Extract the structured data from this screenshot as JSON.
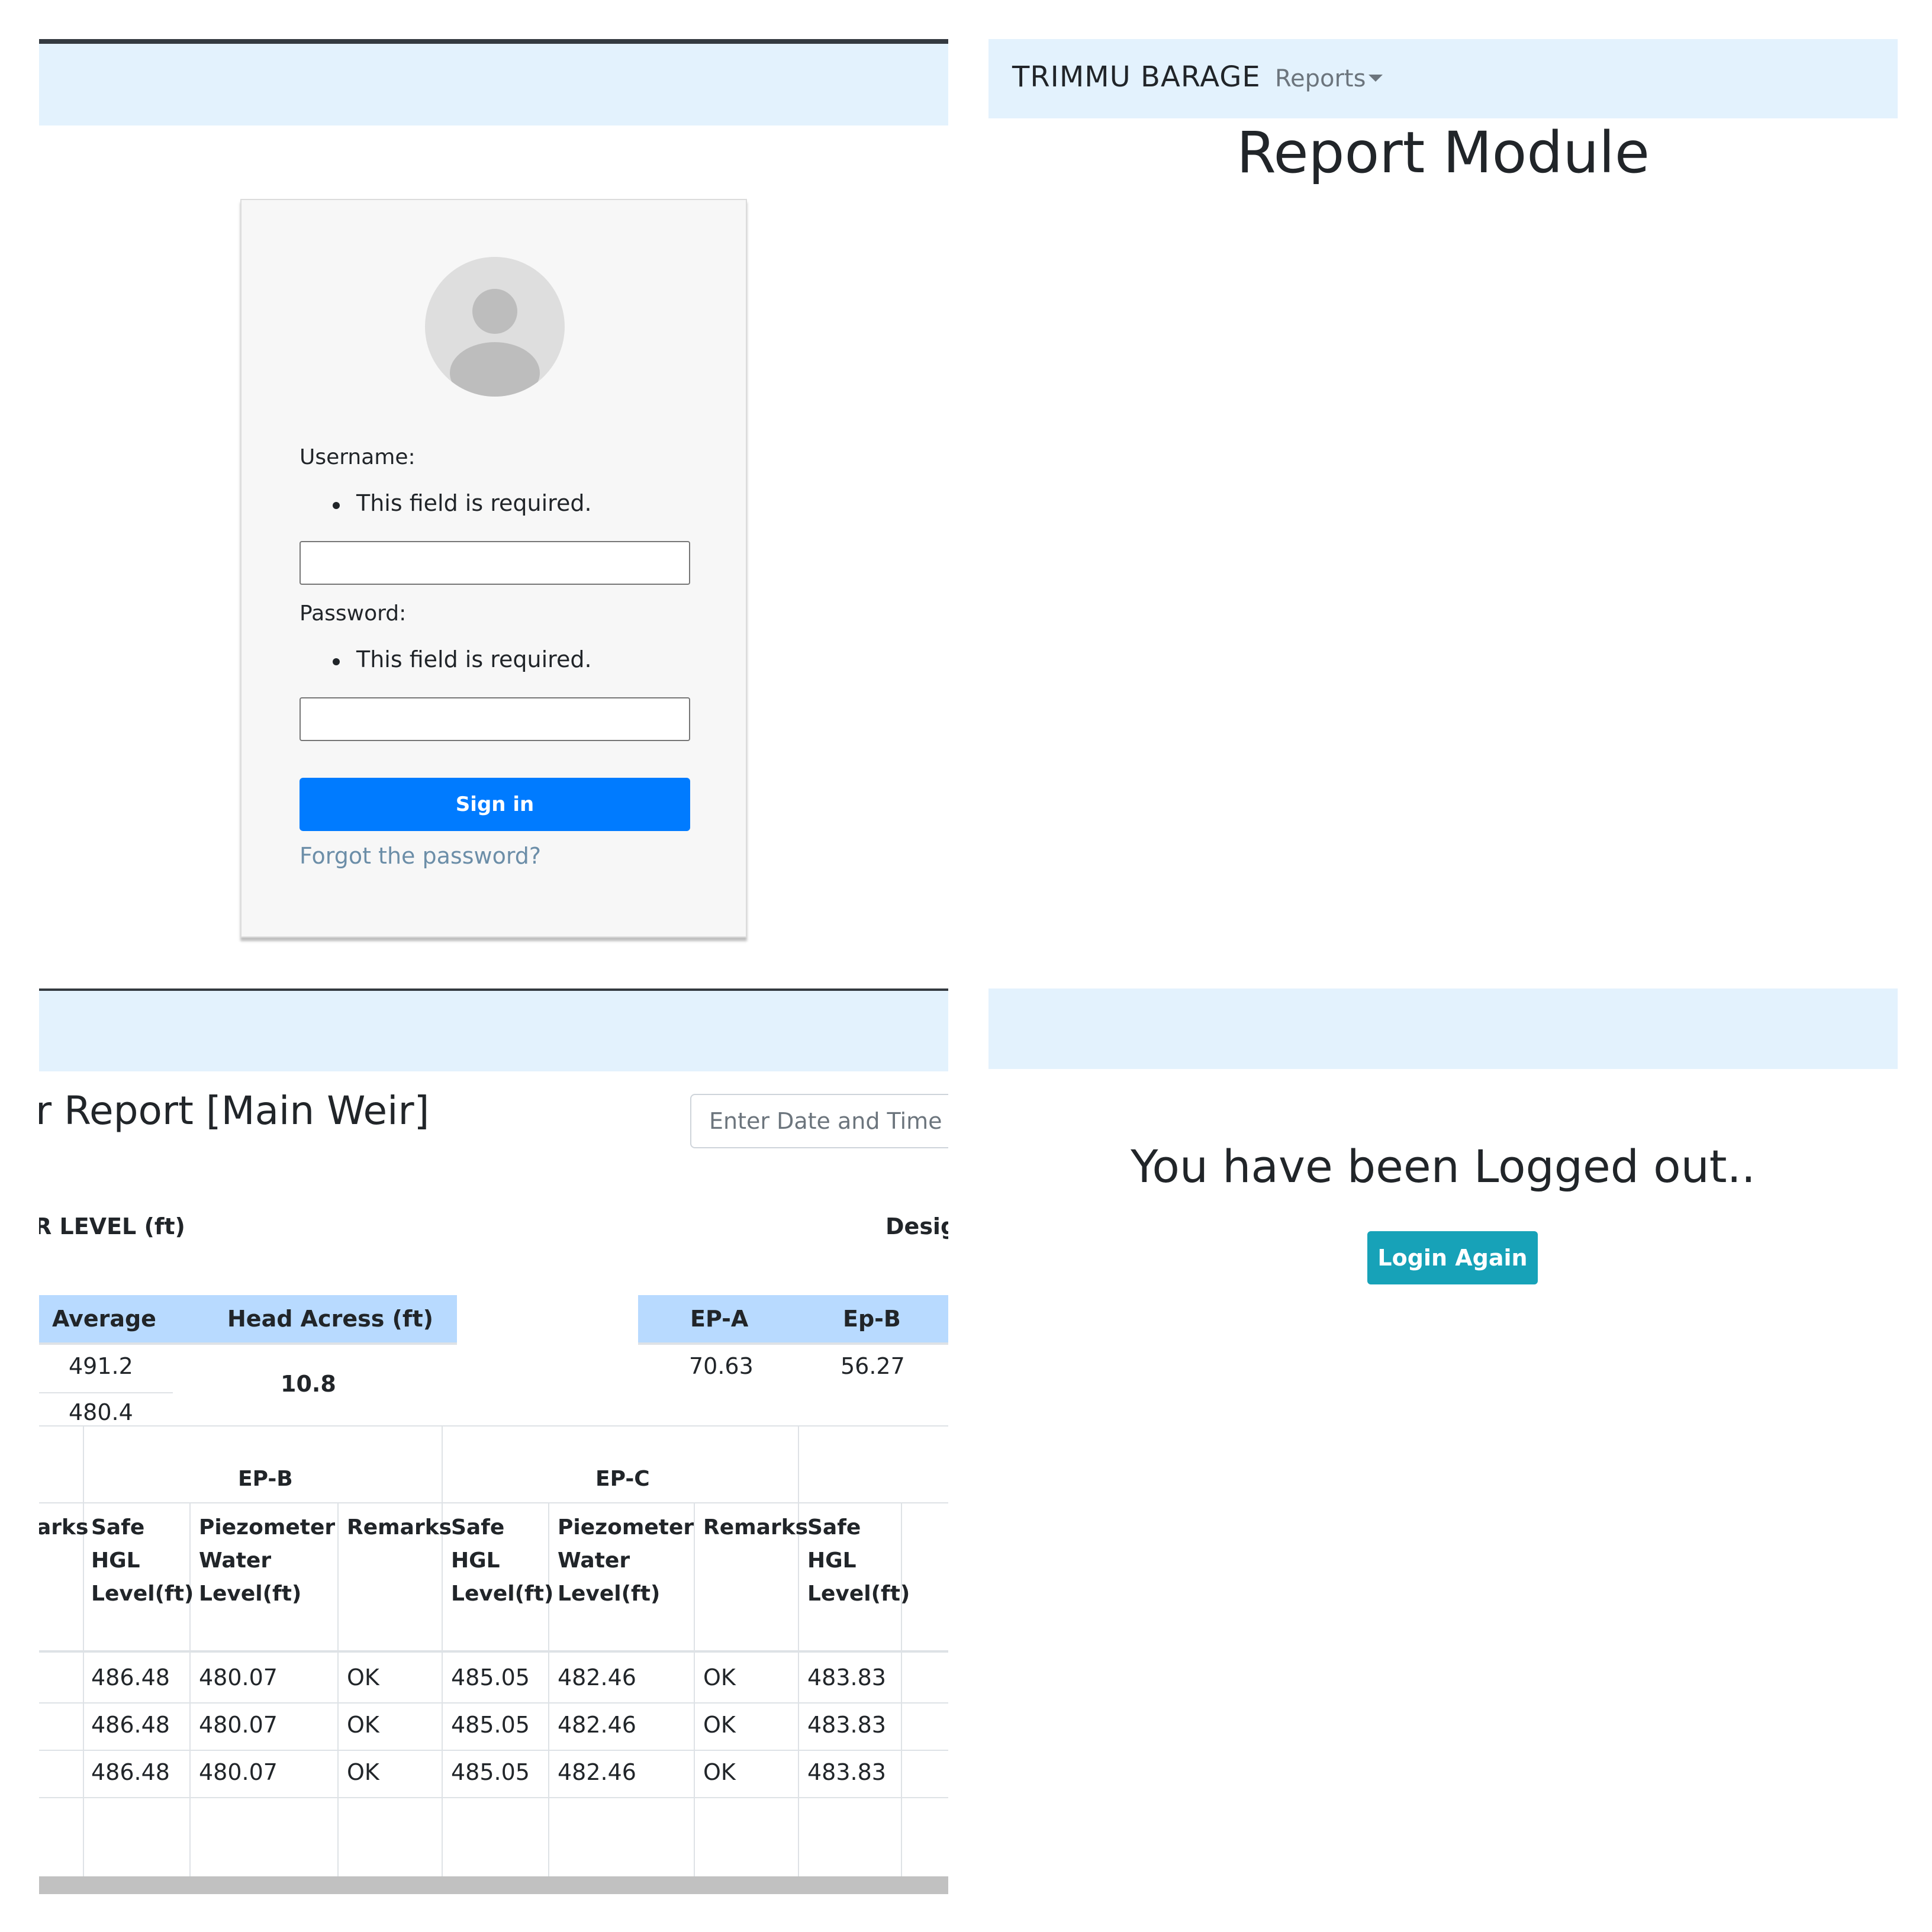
{
  "login": {
    "username_label": "Username:",
    "username_error": "This field is required.",
    "password_label": "Password:",
    "password_error": "This field is required.",
    "signin_label": "Sign in",
    "forgot_label": "Forgot the password?"
  },
  "report_module": {
    "brand": "TRIMMU BARAGE",
    "nav_reports": "Reports",
    "title": "Report Module"
  },
  "weir_report": {
    "title": "r Report [Main Weir]",
    "date_placeholder": "Enter Date and Time",
    "section_left": "R LEVEL (ft)",
    "section_right": "Desig",
    "level_headers": [
      "Average",
      "Head Acress (ft)"
    ],
    "level_values": [
      "491.2",
      "480.4"
    ],
    "head_value": "10.8",
    "ep_headers": [
      "EP-A",
      "Ep-B"
    ],
    "ep_values": [
      "70.63",
      "56.27"
    ],
    "group_headers": [
      "EP-B",
      "EP-C"
    ],
    "col_partial": "arks",
    "col_safe": [
      "Safe",
      "HGL",
      "Level(ft)"
    ],
    "col_piezo": [
      "Piezometer",
      "Water",
      "Level(ft)"
    ],
    "col_remarks": "Remarks",
    "rows": [
      [
        "486.48",
        "480.07",
        "OK",
        "485.05",
        "482.46",
        "OK",
        "483.83"
      ],
      [
        "486.48",
        "480.07",
        "OK",
        "485.05",
        "482.46",
        "OK",
        "483.83"
      ],
      [
        "486.48",
        "480.07",
        "OK",
        "485.05",
        "482.46",
        "OK",
        "483.83"
      ]
    ]
  },
  "logout": {
    "message": "You have been Logged out..",
    "login_again_label": "Login Again"
  },
  "colors": {
    "navbar_bg": "#e3f2fd",
    "primary": "#007bff",
    "info": "#17a2b8",
    "table_header_bg": "#b8daff"
  }
}
